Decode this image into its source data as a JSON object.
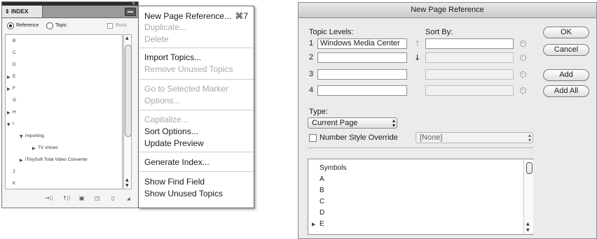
{
  "index_panel": {
    "tab_title": "INDEX",
    "mode_reference": "Reference",
    "mode_topic": "Topic",
    "book_label": "Book",
    "items": [
      {
        "label": "B",
        "level": 0,
        "expander": "none"
      },
      {
        "label": "C",
        "level": 0,
        "expander": "none"
      },
      {
        "label": "D",
        "level": 0,
        "expander": "none"
      },
      {
        "label": "E",
        "level": 0,
        "expander": "collapsed"
      },
      {
        "label": "F",
        "level": 0,
        "expander": "collapsed"
      },
      {
        "label": "G",
        "level": 0,
        "expander": "none"
      },
      {
        "label": "H",
        "level": 0,
        "expander": "collapsed"
      },
      {
        "label": "I",
        "level": 0,
        "expander": "expanded"
      },
      {
        "label": "importing",
        "level": 1,
        "expander": "expanded"
      },
      {
        "label": "TV shows",
        "level": 2,
        "expander": "collapsed"
      },
      {
        "label": "iTinySoft Total Video Converter",
        "level": 1,
        "expander": "collapsed"
      },
      {
        "label": "J",
        "level": 0,
        "expander": "none"
      },
      {
        "label": "K",
        "level": 0,
        "expander": "none"
      }
    ]
  },
  "flyout_menu": {
    "items": [
      {
        "label": "New Page Reference...",
        "shortcut": "⌘7",
        "enabled": true
      },
      {
        "label": "Duplicate...",
        "enabled": false
      },
      {
        "label": "Delete",
        "enabled": false
      },
      {
        "label": "Import Topics...",
        "enabled": true
      },
      {
        "label": "Remove Unused Topics",
        "enabled": false
      },
      {
        "label": "Go to Selected Marker",
        "enabled": false
      },
      {
        "label": "Options...",
        "enabled": false
      },
      {
        "label": "Capitalize...",
        "enabled": false
      },
      {
        "label": "Sort Options...",
        "enabled": true
      },
      {
        "label": "Update Preview",
        "enabled": true
      },
      {
        "label": "Generate Index...",
        "enabled": true
      },
      {
        "label": "Show Find Field",
        "enabled": true
      },
      {
        "label": "Show Unused Topics",
        "enabled": true
      }
    ]
  },
  "dialog": {
    "title": "New Page Reference",
    "topic_levels_label": "Topic Levels:",
    "sort_by_label": "Sort By:",
    "level_numbers": [
      "1",
      "2",
      "3",
      "4"
    ],
    "level_values": [
      "Windows Media Center",
      "",
      "",
      ""
    ],
    "sort_values": [
      "",
      "",
      "",
      ""
    ],
    "buttons": {
      "ok": "OK",
      "cancel": "Cancel",
      "add": "Add",
      "add_all": "Add All"
    },
    "type_label": "Type:",
    "type_value": "Current Page",
    "number_style_label": "Number Style Override",
    "number_style_value": "[None]",
    "topic_list": [
      "Symbols",
      "A",
      "B",
      "C",
      "D",
      "E"
    ]
  }
}
